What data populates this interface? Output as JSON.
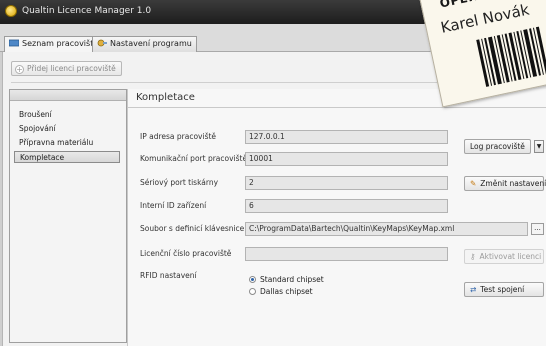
{
  "window": {
    "title": "Qualtin Licence Manager 1.0"
  },
  "tabs": [
    {
      "label": "Seznam pracovišť"
    },
    {
      "label": "Nastavení programu"
    }
  ],
  "toolbar": {
    "add_license_label": "Přidej licenci pracoviště"
  },
  "sidebar": {
    "items": [
      {
        "label": "Broušení"
      },
      {
        "label": "Spojování"
      },
      {
        "label": "Přípravna materiálu"
      },
      {
        "label": "Kompletace"
      }
    ],
    "selected": "Kompletace"
  },
  "panel": {
    "title": "Kompletace",
    "ip_label": "IP adresa pracoviště",
    "ip_value": "127.0.0.1",
    "port_label": "Komunikační port pracoviště",
    "port_value": "10001",
    "serial_label": "Sériový port tiskárny",
    "serial_value": "2",
    "internal_id_label": "Interní ID zařízení",
    "internal_id_value": "6",
    "keyboard_label": "Soubor s definicí klávesnice",
    "keyboard_value": "C:\\ProgramData\\Bartech\\Qualtin\\KeyMaps\\KeyMap.xml",
    "browse_label": "...",
    "license_label": "Licenční číslo pracoviště",
    "license_value": "",
    "rfid_label": "RFID nastavení",
    "rfid_options": [
      {
        "label": "Standard chipset",
        "selected": true
      },
      {
        "label": "Dallas chipset",
        "selected": false
      }
    ]
  },
  "buttons": {
    "log_label": "Log pracoviště",
    "change_settings_label": "Změnit nastavení",
    "activate_license_label": "Aktivovat licenci",
    "test_connection_label": "Test spojení"
  },
  "sticker": {
    "heading": "OPERATO",
    "name": "Karel Novák"
  },
  "colors": {
    "titlebar": "#1d1d1d",
    "panel_bg": "#f7f7f7",
    "radio_selected": "#2f63a8"
  }
}
